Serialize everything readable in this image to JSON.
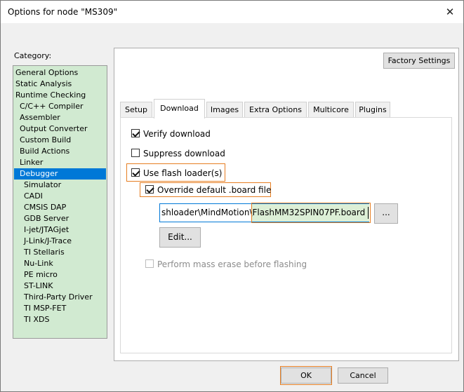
{
  "window": {
    "title": "Options for node \"MS309\"",
    "close_glyph": "✕"
  },
  "category": {
    "label": "Category:",
    "items": [
      {
        "label": "General Options",
        "level": 0,
        "selected": false
      },
      {
        "label": "Static Analysis",
        "level": 0,
        "selected": false
      },
      {
        "label": "Runtime Checking",
        "level": 0,
        "selected": false
      },
      {
        "label": "C/C++ Compiler",
        "level": 1,
        "selected": false
      },
      {
        "label": "Assembler",
        "level": 1,
        "selected": false
      },
      {
        "label": "Output Converter",
        "level": 1,
        "selected": false
      },
      {
        "label": "Custom Build",
        "level": 1,
        "selected": false
      },
      {
        "label": "Build Actions",
        "level": 1,
        "selected": false
      },
      {
        "label": "Linker",
        "level": 1,
        "selected": false
      },
      {
        "label": "Debugger",
        "level": 1,
        "selected": true
      },
      {
        "label": "Simulator",
        "level": 2,
        "selected": false
      },
      {
        "label": "CADI",
        "level": 2,
        "selected": false
      },
      {
        "label": "CMSIS DAP",
        "level": 2,
        "selected": false
      },
      {
        "label": "GDB Server",
        "level": 2,
        "selected": false
      },
      {
        "label": "I-jet/JTAGjet",
        "level": 2,
        "selected": false
      },
      {
        "label": "J-Link/J-Trace",
        "level": 2,
        "selected": false
      },
      {
        "label": "TI Stellaris",
        "level": 2,
        "selected": false
      },
      {
        "label": "Nu-Link",
        "level": 2,
        "selected": false
      },
      {
        "label": "PE micro",
        "level": 2,
        "selected": false
      },
      {
        "label": "ST-LINK",
        "level": 2,
        "selected": false
      },
      {
        "label": "Third-Party Driver",
        "level": 2,
        "selected": false
      },
      {
        "label": "TI MSP-FET",
        "level": 2,
        "selected": false
      },
      {
        "label": "TI XDS",
        "level": 2,
        "selected": false
      }
    ]
  },
  "panel": {
    "factory_settings": "Factory Settings",
    "tabs": [
      {
        "label": "Setup",
        "active": false
      },
      {
        "label": "Download",
        "active": true
      },
      {
        "label": "Images",
        "active": false
      },
      {
        "label": "Extra Options",
        "active": false
      },
      {
        "label": "Multicore",
        "active": false
      },
      {
        "label": "Plugins",
        "active": false
      }
    ],
    "download": {
      "verify_download": {
        "label": "Verify download",
        "checked": true
      },
      "suppress_download": {
        "label": "Suppress download",
        "checked": false
      },
      "use_flash_loader": {
        "label": "Use flash loader(s)",
        "checked": true
      },
      "override_board_file": {
        "label": "Override default .board file",
        "checked": true
      },
      "board_path_visible": "shloader\\MindMotion\\FlashMM32SPIN07PF.board",
      "browse_label": "...",
      "edit_label": "Edit...",
      "mass_erase": {
        "label": "Perform mass erase before flashing",
        "checked": false,
        "enabled": false
      }
    }
  },
  "footer": {
    "ok": "OK",
    "cancel": "Cancel"
  },
  "colors": {
    "category_bg": "#d1ead1",
    "selection": "#0078d7",
    "highlight_box": "#e67e22",
    "path_highlight": "#dcefd6"
  }
}
